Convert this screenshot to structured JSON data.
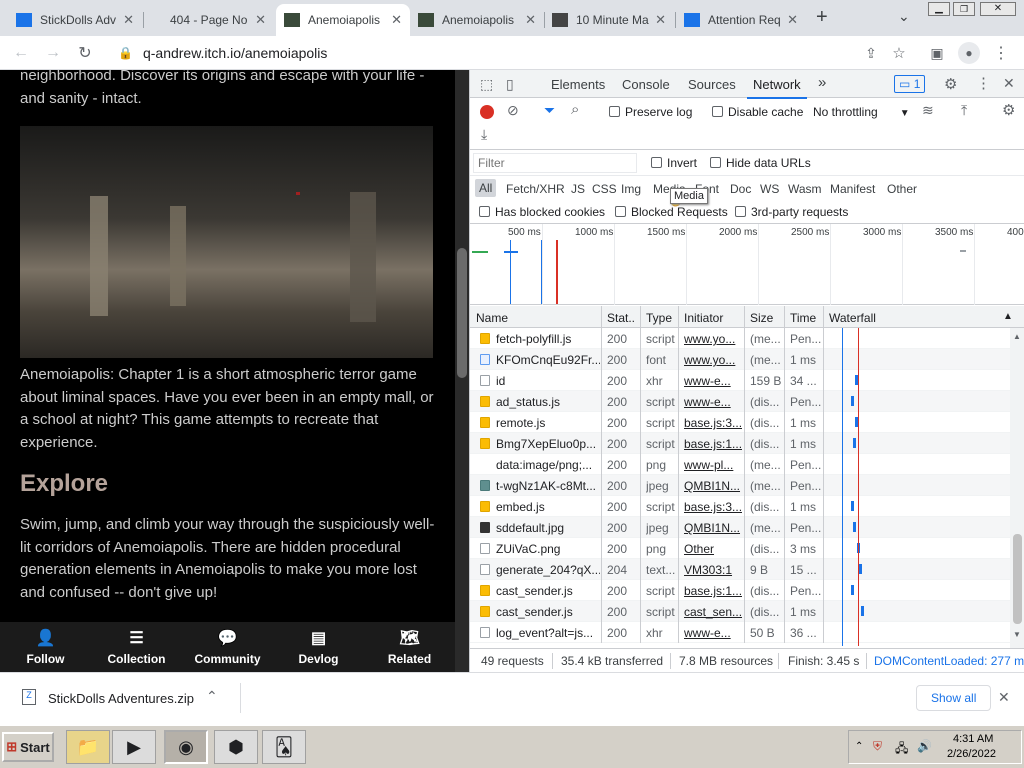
{
  "browser": {
    "tabs": [
      {
        "title": "StickDolls Adv",
        "favicon_color": "#1a73e8",
        "active": false
      },
      {
        "title": "404 - Page No",
        "favicon_color": "",
        "active": false
      },
      {
        "title": "Anemoiapolis",
        "favicon_color": "#3a4a3a",
        "active": true
      },
      {
        "title": "Anemoiapolis",
        "favicon_color": "#3a4a3a",
        "active": false
      },
      {
        "title": "10 Minute Ma",
        "favicon_color": "#444444",
        "active": false
      },
      {
        "title": "Attention Req",
        "favicon_color": "#1a73e8",
        "active": false
      }
    ],
    "new_tab_glyph": "+",
    "url": "q-andrew.itch.io/anemoiapolis"
  },
  "page": {
    "intro_tail": "neighborhood. Discover its origins and escape with your life - and sanity - intact.",
    "description": "Anemoiapolis: Chapter 1 is a short atmospheric terror game about liminal spaces. Have you ever been in an empty mall, or a school at night? This game attempts to recreate that experience.",
    "explore_heading": "Explore",
    "explore_text": "Swim, jump, and climb your way through the suspiciously well-lit corridors of Anemoiapolis. There are hidden procedural generation elements in Anemoiapolis to make you more lost and confused -- don't give up!",
    "bottom_nav": [
      {
        "label": "Follow",
        "icon": "follow-icon",
        "glyph": "👤"
      },
      {
        "label": "Collection",
        "icon": "collection-icon",
        "glyph": "☰"
      },
      {
        "label": "Community",
        "icon": "community-icon",
        "glyph": "💬"
      },
      {
        "label": "Devlog",
        "icon": "devlog-icon",
        "glyph": "▤"
      },
      {
        "label": "Related",
        "icon": "related-icon",
        "glyph": "🗺"
      }
    ]
  },
  "devtools": {
    "panels": [
      "Elements",
      "Console",
      "Sources",
      "Network"
    ],
    "active_panel": "Network",
    "more_glyph": "»",
    "issues_badge": "1",
    "preserve_log": "Preserve log",
    "disable_cache": "Disable cache",
    "throttling": "No throttling",
    "filter_placeholder": "Filter",
    "invert": "Invert",
    "hide_data_urls": "Hide data URLs",
    "types": [
      "All",
      "Fetch/XHR",
      "JS",
      "CSS",
      "Img",
      "Media",
      "Font",
      "Doc",
      "WS",
      "Wasm",
      "Manifest",
      "Other"
    ],
    "tooltip": "Media",
    "has_blocked_cookies": "Has blocked cookies",
    "blocked_requests": "Blocked Requests",
    "third_party": "3rd-party requests",
    "timeline_ticks": [
      "500 ms",
      "1000 ms",
      "1500 ms",
      "2000 ms",
      "2500 ms",
      "3000 ms",
      "3500 ms",
      "400"
    ],
    "columns": [
      "Name",
      "Stat..",
      "Type",
      "Initiator",
      "Size",
      "Time",
      "Waterfall"
    ],
    "requests": [
      {
        "name": "fetch-polyfill.js",
        "status": "200",
        "type": "script",
        "initiator": "www.yo...",
        "size": "(me...",
        "time": "Pen...",
        "icon": "js"
      },
      {
        "name": "KFOmCnqEu92Fr...",
        "status": "200",
        "type": "font",
        "initiator": "www.yo...",
        "size": "(me...",
        "time": "1 ms",
        "icon": "font"
      },
      {
        "name": "id",
        "status": "200",
        "type": "xhr",
        "initiator": "www-e...",
        "size": "159 B",
        "time": "34 ...",
        "icon": "doc"
      },
      {
        "name": "ad_status.js",
        "status": "200",
        "type": "script",
        "initiator": "www-e...",
        "size": "(dis...",
        "time": "Pen...",
        "icon": "js"
      },
      {
        "name": "remote.js",
        "status": "200",
        "type": "script",
        "initiator": "base.js:3...",
        "size": "(dis...",
        "time": "1 ms",
        "icon": "js"
      },
      {
        "name": "Bmg7XepEluo0p...",
        "status": "200",
        "type": "script",
        "initiator": "base.js:1...",
        "size": "(dis...",
        "time": "1 ms",
        "icon": "js"
      },
      {
        "name": "data:image/png;...",
        "status": "200",
        "type": "png",
        "initiator": "www-pl...",
        "size": "(me...",
        "time": "Pen...",
        "icon": "none"
      },
      {
        "name": "t-wgNz1AK-c8Mt...",
        "status": "200",
        "type": "jpeg",
        "initiator": "QMBI1N...",
        "size": "(me...",
        "time": "Pen...",
        "icon": "img"
      },
      {
        "name": "embed.js",
        "status": "200",
        "type": "script",
        "initiator": "base.js:3...",
        "size": "(dis...",
        "time": "1 ms",
        "icon": "js"
      },
      {
        "name": "sddefault.jpg",
        "status": "200",
        "type": "jpeg",
        "initiator": "QMBI1N...",
        "size": "(me...",
        "time": "Pen...",
        "icon": "dark"
      },
      {
        "name": "ZUiVaC.png",
        "status": "200",
        "type": "png",
        "initiator": "Other",
        "size": "(dis...",
        "time": "3 ms",
        "icon": "doc"
      },
      {
        "name": "generate_204?qX...",
        "status": "204",
        "type": "text...",
        "initiator": "VM303:1",
        "size": "9 B",
        "time": "15 ...",
        "icon": "doc"
      },
      {
        "name": "cast_sender.js",
        "status": "200",
        "type": "script",
        "initiator": "base.js:1...",
        "size": "(dis...",
        "time": "Pen...",
        "icon": "js"
      },
      {
        "name": "cast_sender.js",
        "status": "200",
        "type": "script",
        "initiator": "cast_sen...",
        "size": "(dis...",
        "time": "1 ms",
        "icon": "js"
      },
      {
        "name": "log_event?alt=js...",
        "status": "200",
        "type": "xhr",
        "initiator": "www-e...",
        "size": "50 B",
        "time": "36 ...",
        "icon": "doc"
      }
    ],
    "status": {
      "requests": "49 requests",
      "transferred": "35.4 kB transferred",
      "resources": "7.8 MB resources",
      "finish": "Finish: 3.45 s",
      "dcl": "DOMContentLoaded: 277 m"
    }
  },
  "download": {
    "file": "StickDolls Adventures.zip",
    "show_all": "Show all"
  },
  "taskbar": {
    "start": "Start",
    "time": "4:31 AM",
    "date": "2/26/2022"
  },
  "colors": {
    "accent": "#1a73e8",
    "record": "#d93025",
    "waterfall_red": "#d93025",
    "waterfall_blue": "#1a73e8"
  }
}
